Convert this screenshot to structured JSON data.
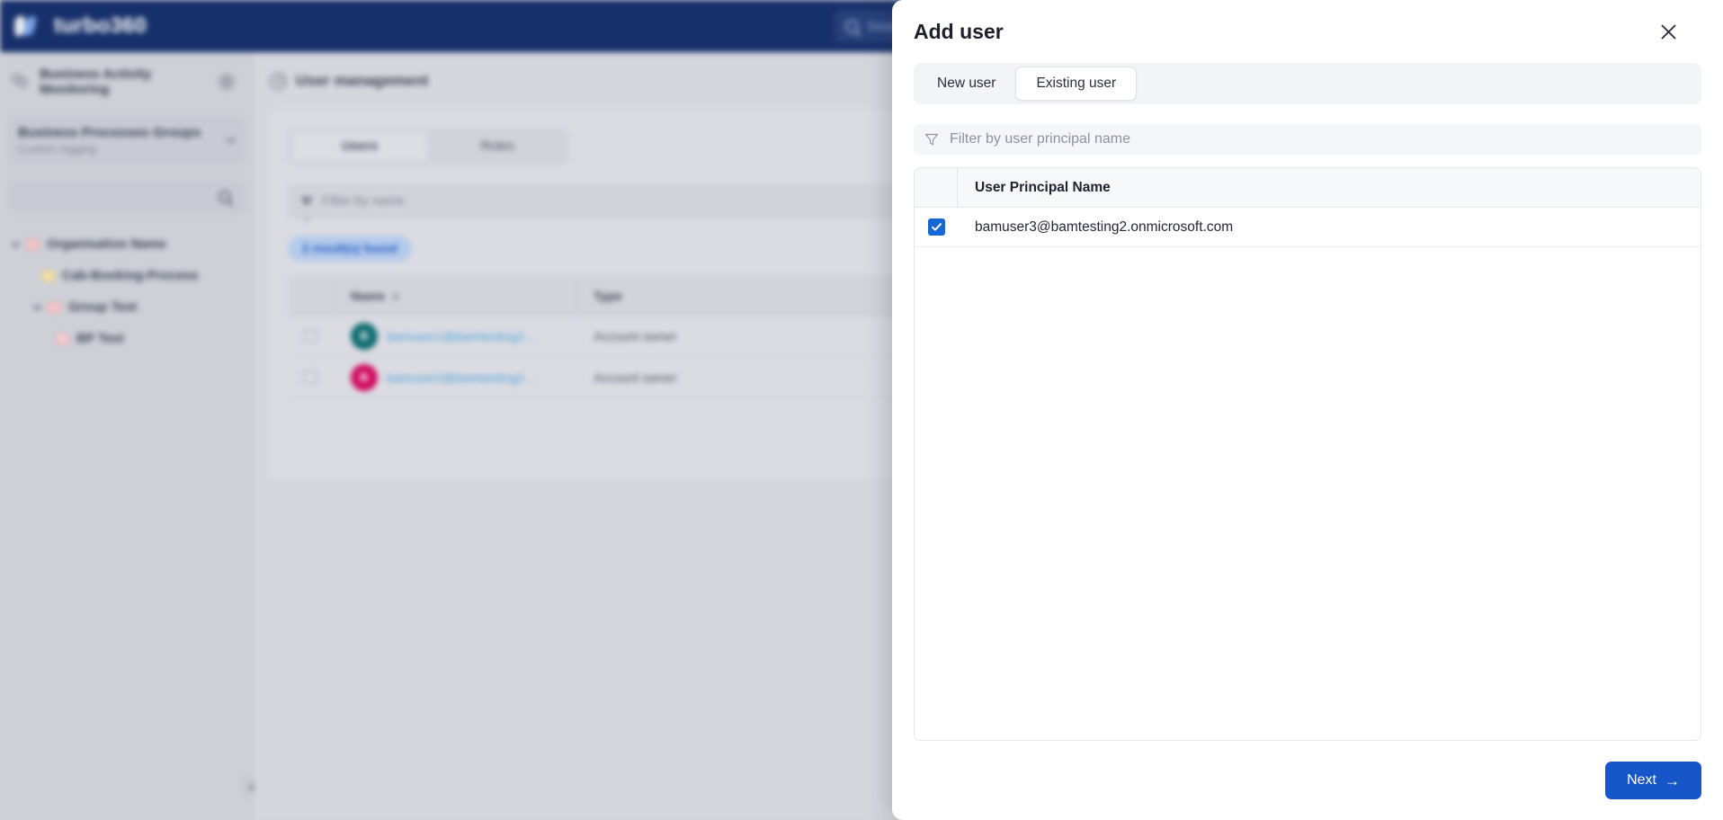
{
  "app": {
    "brand_name": "turbo360",
    "search_placeholder": "Search"
  },
  "sidebar": {
    "section_label": "Business Activity Monitoring",
    "group_title": "Business Processes Groups",
    "group_subtitle": "Custom logging",
    "tree": [
      {
        "label": "Organisation Name",
        "level": 1,
        "icon": "folder-red-icon",
        "expanded": true
      },
      {
        "label": "Cab-Booking-Process",
        "level": 2,
        "icon": "folder-yellow-icon",
        "expanded": false
      },
      {
        "label": "Group Test",
        "level": 3,
        "icon": "folder-red-icon",
        "expanded": true
      },
      {
        "label": "BP Test",
        "level": 4,
        "icon": "document-red-icon",
        "expanded": false
      }
    ]
  },
  "main": {
    "page_title": "User management",
    "tabs": [
      {
        "label": "Users",
        "active": true
      },
      {
        "label": "Roles",
        "active": false
      }
    ],
    "filter_placeholder": "Filter by name",
    "results_badge": "2 result(s) found",
    "columns": [
      "Name",
      "Type"
    ],
    "rows": [
      {
        "name": "bamuser1@bamtesting2...",
        "type": "Account owner",
        "avatar_initial": "B",
        "avatar_color": "#0d6b70"
      },
      {
        "name": "bamuser2@bamtesting2...",
        "type": "Account owner",
        "avatar_initial": "B",
        "avatar_color": "#d1095e"
      }
    ]
  },
  "modal": {
    "title": "Add user",
    "close_icon": "close-icon",
    "tabs": [
      {
        "label": "New user",
        "active": false
      },
      {
        "label": "Existing user",
        "active": true
      }
    ],
    "filter_placeholder": "Filter by user principal name",
    "list": {
      "column_header": "User Principal Name",
      "rows": [
        {
          "user_principal_name": "bamuser3@bamtesting2.onmicrosoft.com",
          "checked": true
        }
      ]
    },
    "footer": {
      "next_label": "Next",
      "next_arrow": "→"
    }
  },
  "colors": {
    "brand_navy": "#16306b",
    "accent_blue": "#1756c8",
    "checkbox_blue": "#1766d6"
  }
}
